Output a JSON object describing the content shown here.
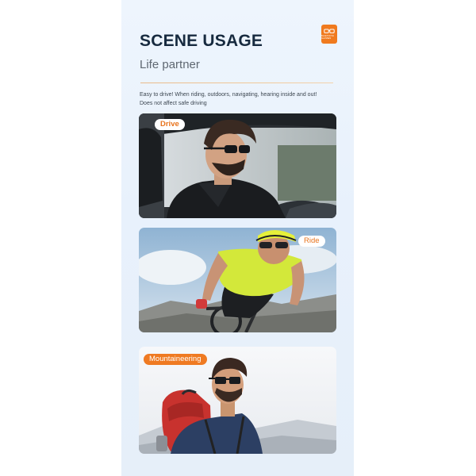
{
  "header": {
    "title": "SCENE USAGE",
    "subtitle": "Life partner",
    "badge_icon": "glasses-icon",
    "badge_label": "BLUETOOTH GLASSES"
  },
  "description": {
    "line1": "Easy to drive! When riding, outdoors, navigating, hearing inside and out!",
    "line2": "Does not affect safe driving"
  },
  "scenes": [
    {
      "label": "Drive"
    },
    {
      "label": "Ride"
    },
    {
      "label": "Mountaineering"
    }
  ],
  "colors": {
    "accent": "#ef7a22",
    "title": "#172a3f",
    "panel_bg": "#e8f1fc"
  }
}
